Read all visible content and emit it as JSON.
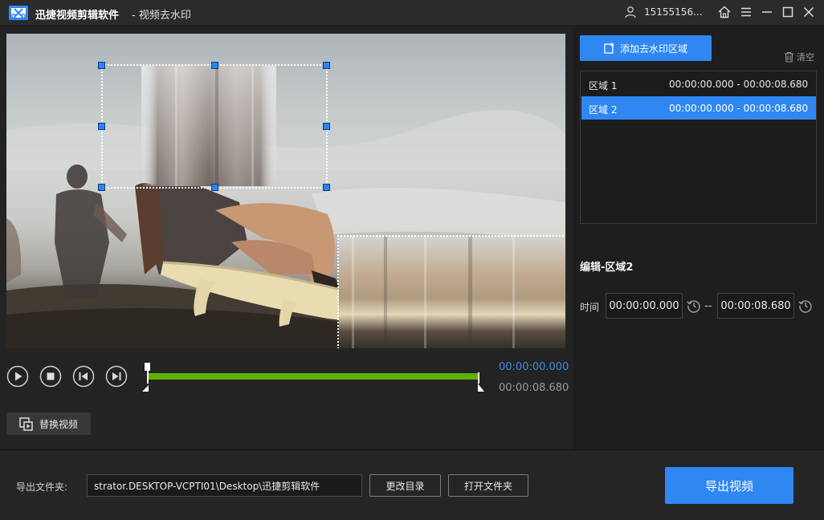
{
  "titlebar": {
    "app_name": "迅捷视频剪辑软件",
    "page_name": "- 视频去水印",
    "user_phone": "15155156..."
  },
  "player": {
    "current_time": "00:00:00.000",
    "end_time": "00:00:08.680",
    "replace_label": "替换视频"
  },
  "regions": {
    "add_label": "添加去水印区域",
    "clear_label": "清空",
    "items": [
      {
        "name": "区域 1",
        "range": "00:00:00.000 - 00:00:08.680"
      },
      {
        "name": "区域 2",
        "range": "00:00:00.000 - 00:00:08.680"
      }
    ],
    "selected_index": 1
  },
  "edit": {
    "title": "编辑-区域2",
    "time_label": "时间",
    "start": "00:00:00.000",
    "separator": "--",
    "end": "00:00:08.680"
  },
  "bottom": {
    "export_folder_label": "导出文件夹:",
    "path": "strator.DESKTOP-VCPTI01\\Desktop\\迅捷剪辑软件",
    "change_dir_label": "更改目录",
    "open_folder_label": "打开文件夹",
    "export_label": "导出视频"
  },
  "colors": {
    "accent": "#2f87f2",
    "timeline": "#5db100"
  }
}
